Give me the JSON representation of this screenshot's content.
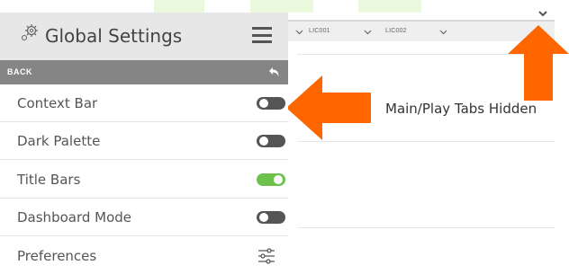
{
  "panel": {
    "title": "Global Settings",
    "back_label": "BACK",
    "settings": [
      {
        "label": "Context Bar",
        "control": "toggle",
        "on": false
      },
      {
        "label": "Dark Palette",
        "control": "toggle",
        "on": false
      },
      {
        "label": "Title Bars",
        "control": "toggle",
        "on": true
      },
      {
        "label": "Dashboard Mode",
        "control": "toggle",
        "on": false
      },
      {
        "label": "Preferences",
        "control": "sliders-icon"
      }
    ]
  },
  "context_strip": {
    "items": [
      "LIC001",
      "LIC002"
    ]
  },
  "annotation": {
    "text": "Main/Play Tabs Hidden"
  },
  "colors": {
    "arrow": "#ff6600",
    "toggle_on": "#6cc24a",
    "toggle_off": "#555555",
    "back_bar": "#858585",
    "header": "#e7e7e7"
  },
  "icons": [
    "gear-icon",
    "hamburger-menu-icon",
    "back-arrow-icon",
    "sliders-icon",
    "chevron-down-icon"
  ]
}
